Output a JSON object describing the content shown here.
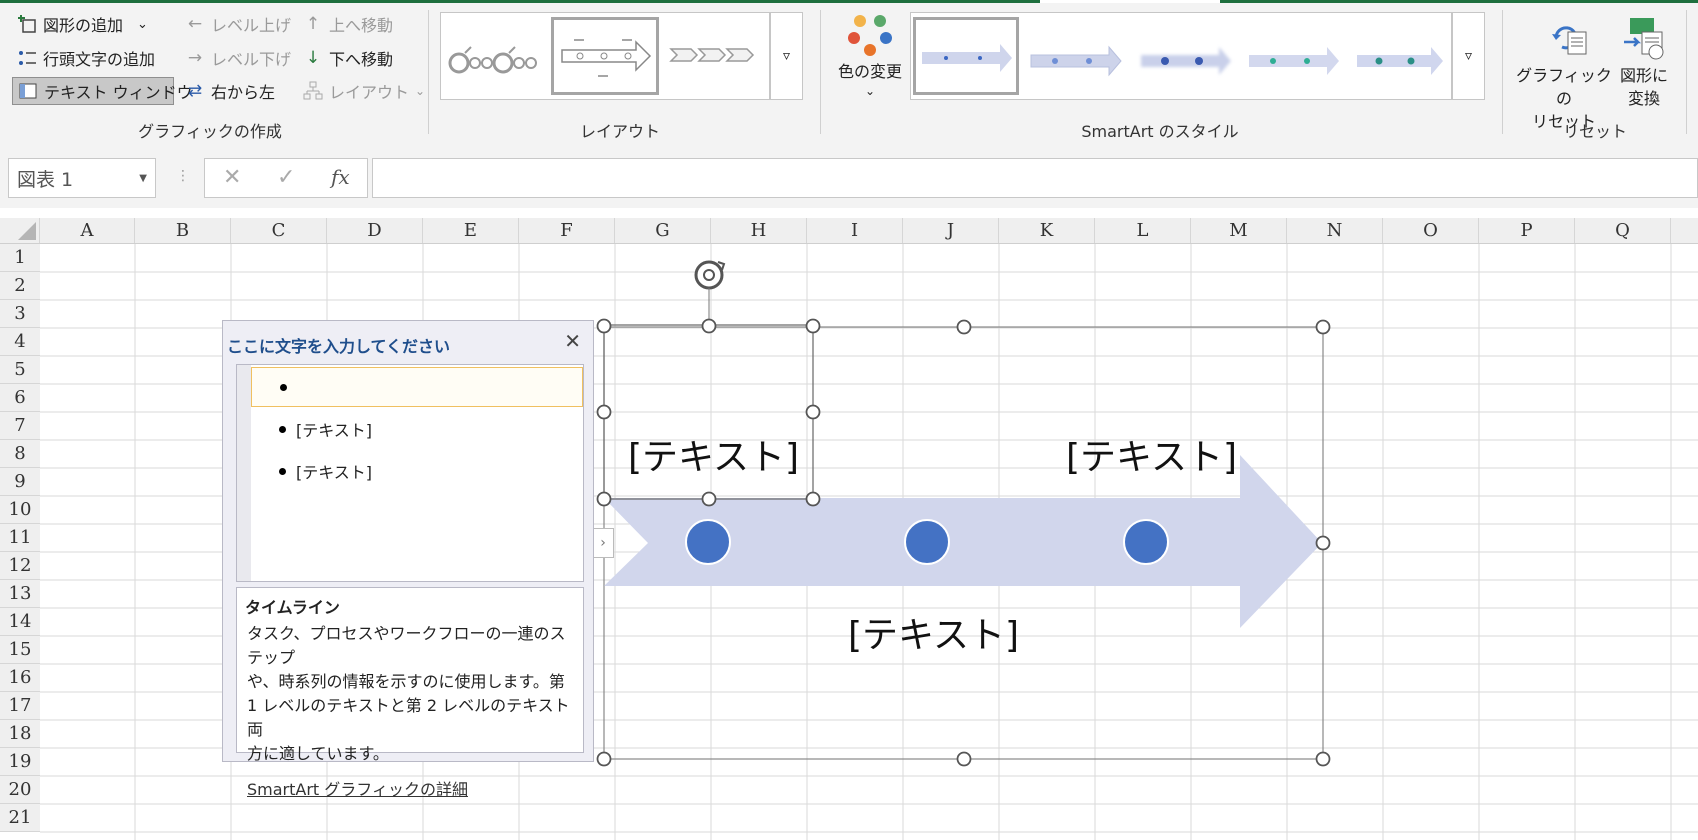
{
  "ribbon": {
    "create_group": {
      "label": "グラフィックの作成",
      "add_shape": "図形の追加",
      "add_bullet": "行頭文字の追加",
      "text_pane": "テキスト ウィンドウ",
      "promote": "レベル上げ",
      "demote": "レベル下げ",
      "right_to_left": "右から左",
      "move_up": "上へ移動",
      "move_down": "下へ移動",
      "layout": "レイアウト"
    },
    "layout_group": {
      "label": "レイアウト"
    },
    "styles_group": {
      "label": "SmartArt のスタイル",
      "change_colors": "色の変更"
    },
    "reset_group": {
      "label": "リセット",
      "reset_graphic_l1": "グラフィックの",
      "reset_graphic_l2": "リセット",
      "convert_l1": "図形に",
      "convert_l2": "変換"
    }
  },
  "formula_bar": {
    "name_box": "図表 1",
    "fx": "fx",
    "formula": ""
  },
  "columns": [
    "A",
    "B",
    "C",
    "D",
    "E",
    "F",
    "G",
    "H",
    "I",
    "J",
    "K",
    "L",
    "M",
    "N",
    "O",
    "P",
    "Q"
  ],
  "rows": [
    "1",
    "2",
    "3",
    "4",
    "5",
    "6",
    "7",
    "8",
    "9",
    "10",
    "11",
    "12",
    "13",
    "14",
    "15",
    "16",
    "17",
    "18",
    "19",
    "20",
    "21"
  ],
  "text_pane": {
    "title": "ここに文字を入力してください",
    "items": [
      "",
      "[テキスト]",
      "[テキスト]"
    ],
    "desc_title": "タイムライン",
    "desc_lines": [
      "タスク、プロセスやワークフローの一連のステップ",
      "や、時系列の情報を示すのに使用します。第",
      "1 レベルのテキストと第 2 レベルのテキスト両",
      "方に適しています。"
    ],
    "link": "SmartArt グラフィックの詳細"
  },
  "smartart": {
    "labels": [
      "[テキスト]",
      "[テキスト]",
      "[テキスト]"
    ],
    "arrow_color": "#d1d6ec",
    "dot_color": "#4472c4"
  }
}
